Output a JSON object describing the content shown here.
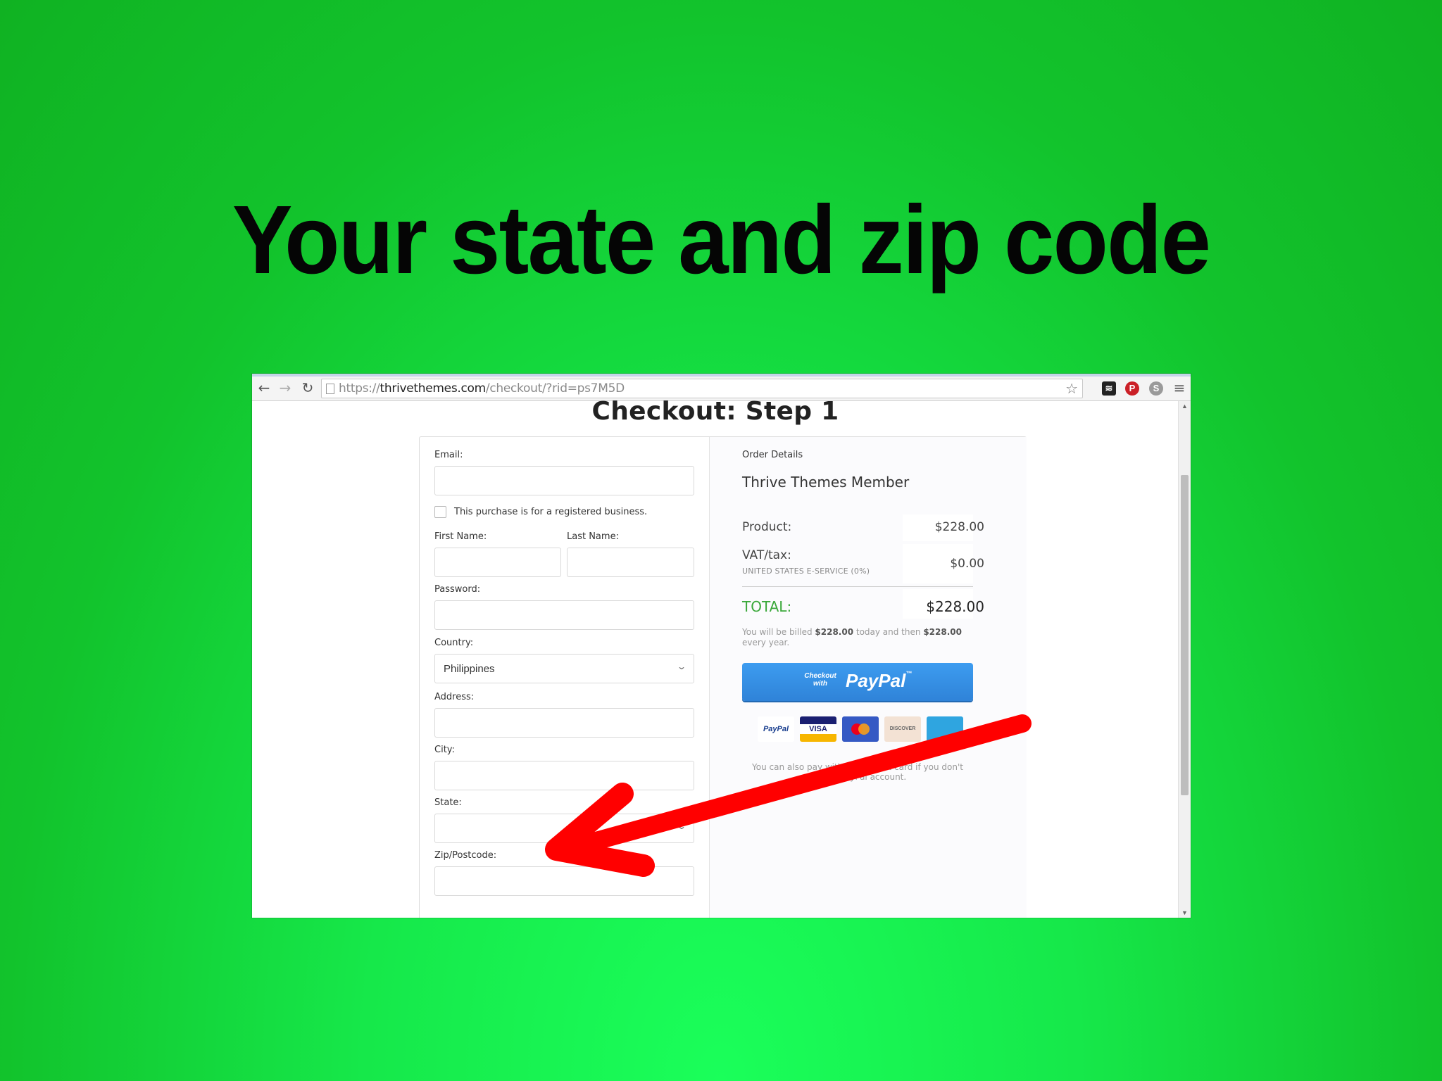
{
  "headline": "Your state and zip code",
  "browser": {
    "url_prefix": "https://",
    "url_host": "thrivethemes.com",
    "url_path": "/checkout/?rid=ps7M5D",
    "back_icon": "←",
    "forward_icon": "→",
    "reload_icon": "↻",
    "star_icon": "☆",
    "menu_icon": "≡"
  },
  "page": {
    "title": "Checkout: Step 1"
  },
  "form": {
    "email_label": "Email:",
    "business_label": "This purchase is for a registered business.",
    "first_name_label": "First Name:",
    "last_name_label": "Last Name:",
    "password_label": "Password:",
    "country_label": "Country:",
    "country_value": "Philippines",
    "address_label": "Address:",
    "city_label": "City:",
    "state_label": "State:",
    "state_value": "",
    "zip_label": "Zip/Postcode:"
  },
  "order": {
    "heading": "Order Details",
    "product_name": "Thrive Themes Member",
    "product_label": "Product:",
    "product_value": "$228.00",
    "vat_label": "VAT/tax:",
    "vat_sub": "UNITED STATES E-SERVICE (0%)",
    "vat_value": "$0.00",
    "total_label": "TOTAL:",
    "total_value": "$228.00",
    "billed_pre": "You will be billed ",
    "billed_amount1": "$228.00",
    "billed_mid": " today and then ",
    "billed_amount2": "$228.00",
    "billed_post": " every year.",
    "paypal_small": "Checkout with",
    "paypal_big": "PayPal",
    "paypal_tm": "™",
    "card_paypal": "PayPal",
    "card_visa": "VISA",
    "card_discover": "DISCOVER",
    "note": "You can also pay with your credit card if you don't have a PayPal account."
  },
  "colors": {
    "background": "#12c32c",
    "arrow": "#ff0000",
    "paypal_button": "#3d9cf0",
    "total_green": "#3aa83a"
  }
}
